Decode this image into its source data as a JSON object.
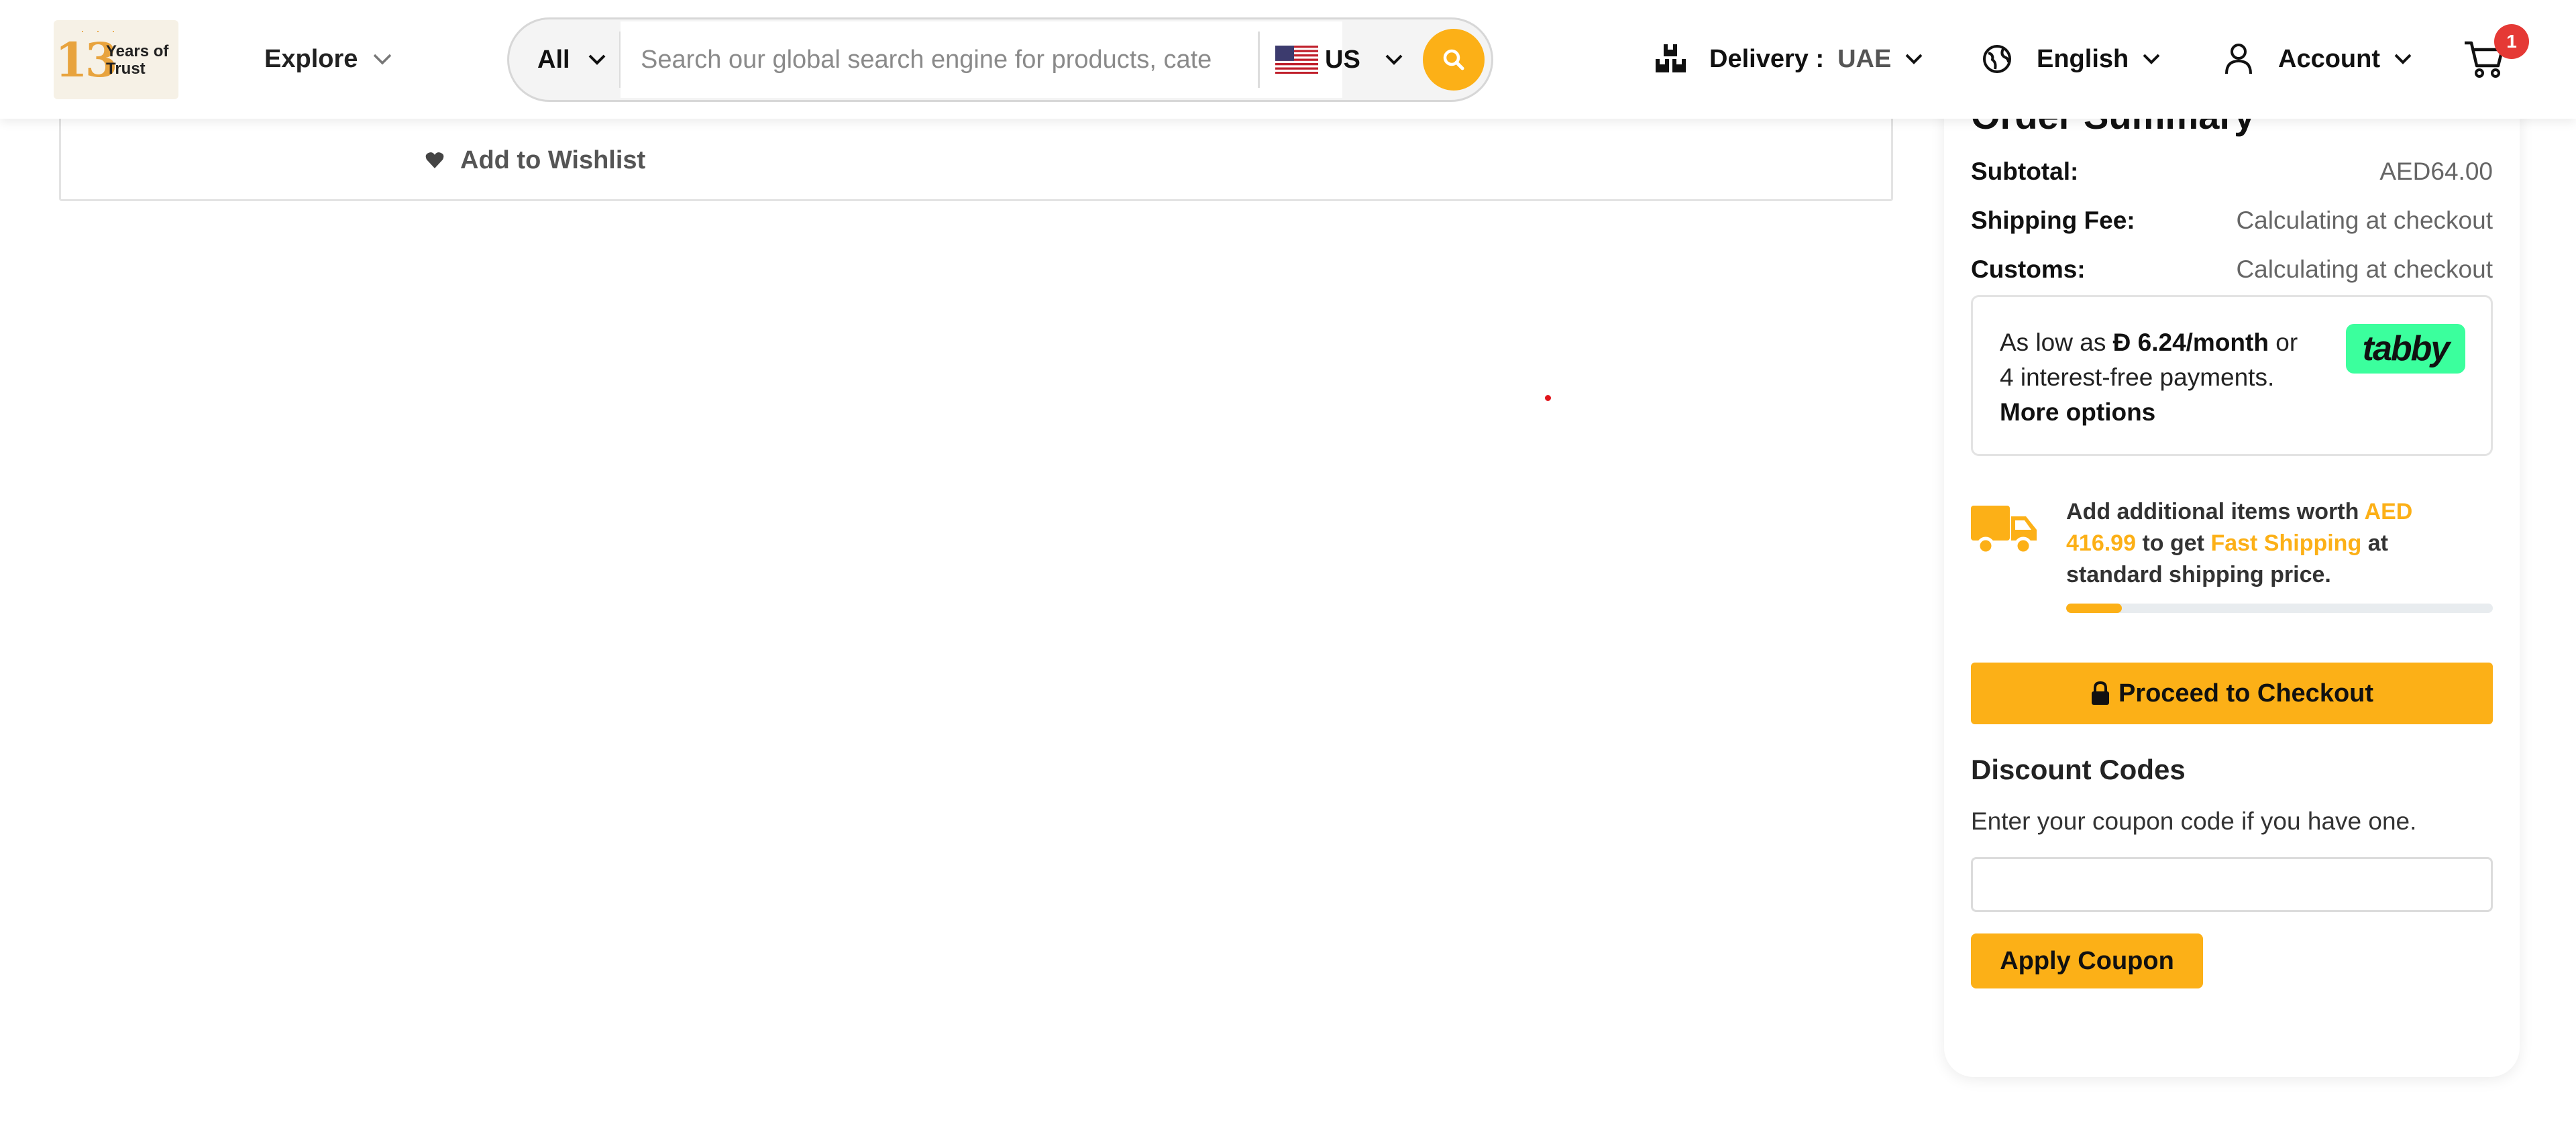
{
  "header": {
    "logo": {
      "number": "13",
      "text_line1": "Years of",
      "text_line2": "Trust"
    },
    "explore_label": "Explore",
    "search": {
      "category": "All",
      "placeholder": "Search our global search engine for products, cate",
      "country": "US"
    },
    "delivery": {
      "label": "Delivery :",
      "value": "UAE"
    },
    "language": "English",
    "account": "Account",
    "cart_count": "1"
  },
  "main": {
    "wishlist_label": "Add to Wishlist"
  },
  "summary": {
    "title": "Order Summary",
    "rows": [
      {
        "label": "Subtotal:",
        "value": "AED64.00"
      },
      {
        "label": "Shipping Fee:",
        "value": "Calculating at checkout"
      },
      {
        "label": "Customs:",
        "value": "Calculating at checkout"
      }
    ],
    "tabby": {
      "prefix": "As low as",
      "currency_symbol": "Đ",
      "amount": "6.24/month",
      "suffix": "or",
      "line2": "4 interest-free payments.",
      "more": "More options",
      "logo": "tabby"
    },
    "shipping_promo": {
      "part1": "Add additional items worth",
      "amount": "AED 416.99",
      "part2": "to get",
      "highlight": "Fast Shipping",
      "part3": "at standard shipping price.",
      "progress_percent": 13
    },
    "checkout_label": "Proceed to Checkout",
    "discount": {
      "title": "Discount Codes",
      "description": "Enter your coupon code if you have one.",
      "input_value": "",
      "apply_label": "Apply Coupon"
    }
  },
  "colors": {
    "accent": "#fcb017",
    "tabby": "#3bff9d",
    "badge": "#e53935"
  }
}
